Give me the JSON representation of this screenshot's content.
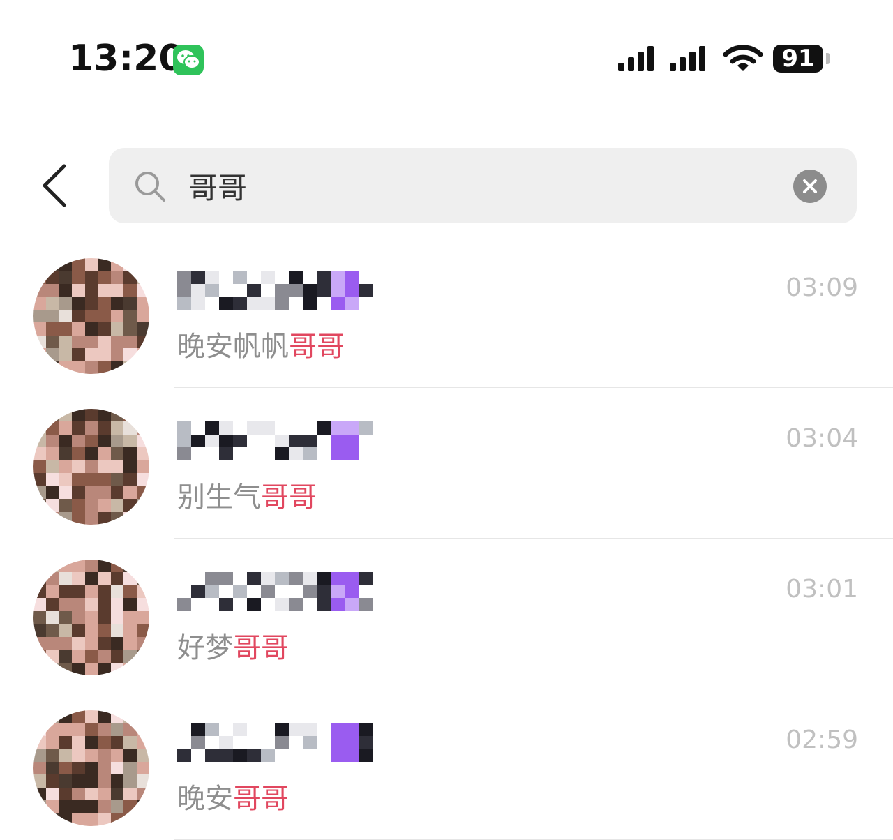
{
  "status_bar": {
    "time": "13:20",
    "notification_app_icon": "wechat-icon",
    "battery": "91",
    "colors": {
      "wechat_green": "#2fc35a"
    }
  },
  "search": {
    "query": "哥哥",
    "back_icon": "chevron-left-icon",
    "search_icon": "magnifier-icon",
    "clear_icon": "close-circle-icon"
  },
  "results": [
    {
      "time": "03:09",
      "message_prefix": "晚安帆帆",
      "message_highlight": "哥哥",
      "name": "redacted-pixelated",
      "avatar": "redacted-pixelated"
    },
    {
      "time": "03:04",
      "message_prefix": "别生气",
      "message_highlight": "哥哥",
      "name": "redacted-pixelated",
      "avatar": "redacted-pixelated"
    },
    {
      "time": "03:01",
      "message_prefix": "好梦",
      "message_highlight": "哥哥",
      "name": "redacted-pixelated",
      "avatar": "redacted-pixelated"
    },
    {
      "time": "02:59",
      "message_prefix": "晚安",
      "message_highlight": "哥哥",
      "name": "redacted-pixelated",
      "avatar": "redacted-pixelated"
    }
  ],
  "colors": {
    "highlight": "#e1475f",
    "timestamp": "#c0c0c0",
    "message": "#8e8e8e"
  }
}
